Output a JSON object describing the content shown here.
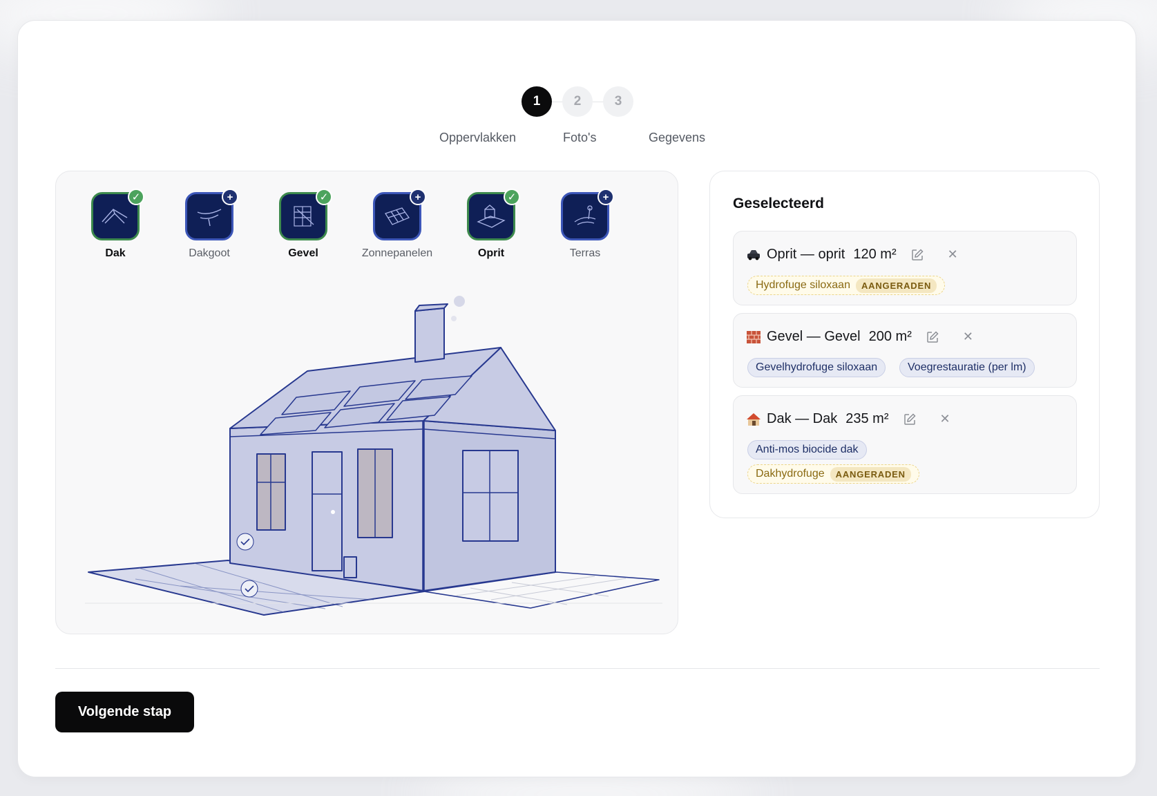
{
  "stepper": {
    "steps": [
      {
        "number": "1",
        "label": "Oppervlakken",
        "active": true
      },
      {
        "number": "2",
        "label": "Foto's",
        "active": false
      },
      {
        "number": "3",
        "label": "Gegevens",
        "active": false
      }
    ]
  },
  "surfaces": [
    {
      "label": "Dak",
      "selected": true,
      "icon": "roof-icon"
    },
    {
      "label": "Dakgoot",
      "selected": false,
      "icon": "gutter-icon"
    },
    {
      "label": "Gevel",
      "selected": true,
      "icon": "facade-icon"
    },
    {
      "label": "Zonnepanelen",
      "selected": false,
      "icon": "solar-panel-icon"
    },
    {
      "label": "Oprit",
      "selected": true,
      "icon": "driveway-icon"
    },
    {
      "label": "Terras",
      "selected": false,
      "icon": "terrace-icon"
    }
  ],
  "selected_panel": {
    "title": "Geselecteerd",
    "items": [
      {
        "icon": "car-icon",
        "name": "Oprit — oprit",
        "area": "120 m²",
        "chips": [
          {
            "text": "Hydrofuge siloxaan",
            "recommended": true,
            "badge": "AANGERADEN"
          }
        ]
      },
      {
        "icon": "brick-icon",
        "name": "Gevel — Gevel",
        "area": "200 m²",
        "chips": [
          {
            "text": "Gevelhydrofuge siloxaan",
            "recommended": false
          },
          {
            "text": "Voegrestauratie (per lm)",
            "recommended": false
          }
        ]
      },
      {
        "icon": "house-icon",
        "name": "Dak — Dak",
        "area": "235 m²",
        "chips": [
          {
            "text": "Anti-mos biocide dak",
            "recommended": false
          },
          {
            "text": "Dakhydrofuge",
            "recommended": true,
            "badge": "AANGERADEN"
          }
        ]
      }
    ]
  },
  "footer": {
    "next_label": "Volgende stap"
  },
  "colors": {
    "navy": "#0f1f56",
    "outline": "#27388f",
    "selected_green": "#4ca35d",
    "chip_blue": "#e6e9f4",
    "chip_yellow": "#fffbea"
  }
}
